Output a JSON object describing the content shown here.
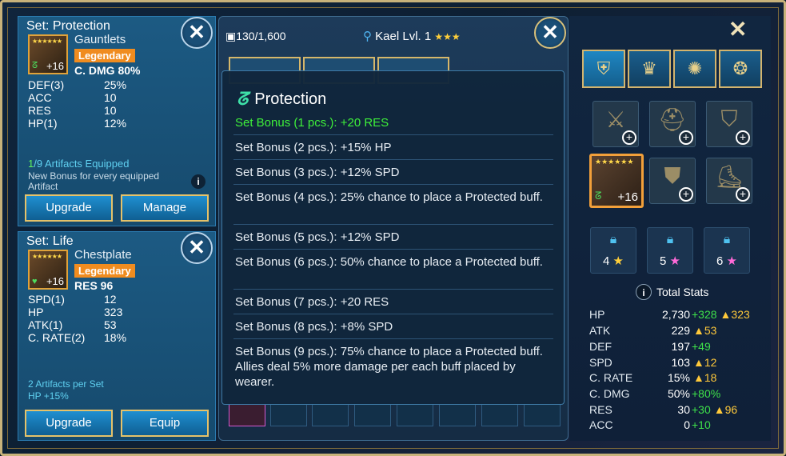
{
  "panel_top": {
    "set_title": "Set: Protection",
    "item_name": "Gauntlets",
    "rarity": "Legendary",
    "main_stat": "C. DMG 80%",
    "level": "+16",
    "substats": [
      {
        "k": "DEF(3)",
        "v": "25%"
      },
      {
        "k": "ACC",
        "v": "10"
      },
      {
        "k": "RES",
        "v": "10"
      },
      {
        "k": "HP(1)",
        "v": "12%"
      }
    ],
    "equipped_count": "1",
    "equipped_text": "/9 Artifacts Equipped",
    "note": "New Bonus for every equipped Artifact",
    "upgrade_label": "Upgrade",
    "manage_label": "Manage"
  },
  "panel_bottom": {
    "set_title": "Set: Life",
    "item_name": "Chestplate",
    "rarity": "Legendary",
    "main_stat": "RES 96",
    "level": "+16",
    "substats": [
      {
        "k": "SPD(1)",
        "v": "12"
      },
      {
        "k": "HP",
        "v": "323"
      },
      {
        "k": "ATK(1)",
        "v": "53"
      },
      {
        "k": "C. RATE(2)",
        "v": "18%"
      }
    ],
    "note1": "2 Artifacts per Set",
    "note2": "HP +15%",
    "upgrade_label": "Upgrade",
    "equip_label": "Equip"
  },
  "storage": {
    "capacity": "130/1,600",
    "hero": "Kael Lvl. 1",
    "hero_stars": "★★★"
  },
  "tooltip": {
    "title": "Protection",
    "bonuses": [
      "Set Bonus (1 pcs.): +20 RES",
      "Set Bonus (2 pcs.): +15% HP",
      "Set Bonus (3 pcs.): +12% SPD",
      "Set Bonus (4 pcs.): 25% chance to place a Protected buff.",
      "Set Bonus (5 pcs.): +12% SPD",
      "Set Bonus (6 pcs.): 50% chance to place a Protected buff.",
      "Set Bonus (7 pcs.): +20 RES",
      "Set Bonus (8 pcs.): +8% SPD",
      "Set Bonus (9 pcs.): 75% chance to place a Protected buff. Allies deal 5% more damage per each buff placed by wearer."
    ]
  },
  "equipment": {
    "filled_level": "+16",
    "accessory_reqs": [
      {
        "num": "4",
        "star": "gold"
      },
      {
        "num": "5",
        "star": "pink"
      },
      {
        "num": "6",
        "star": "pink"
      }
    ]
  },
  "total_stats": {
    "title": "Total Stats",
    "rows": [
      {
        "k": "HP",
        "base": "2,730",
        "green": "+328",
        "gold": "323"
      },
      {
        "k": "ATK",
        "base": "229",
        "green": "",
        "gold": "53"
      },
      {
        "k": "DEF",
        "base": "197",
        "green": "+49",
        "gold": ""
      },
      {
        "k": "SPD",
        "base": "103",
        "green": "",
        "gold": "12"
      },
      {
        "k": "C. RATE",
        "base": "15%",
        "green": "",
        "gold": "18"
      },
      {
        "k": "C. DMG",
        "base": "50%",
        "green": "+80%",
        "gold": ""
      },
      {
        "k": "RES",
        "base": "30",
        "green": "+30",
        "gold": "96"
      },
      {
        "k": "ACC",
        "base": "0",
        "green": "+10",
        "gold": ""
      }
    ]
  }
}
